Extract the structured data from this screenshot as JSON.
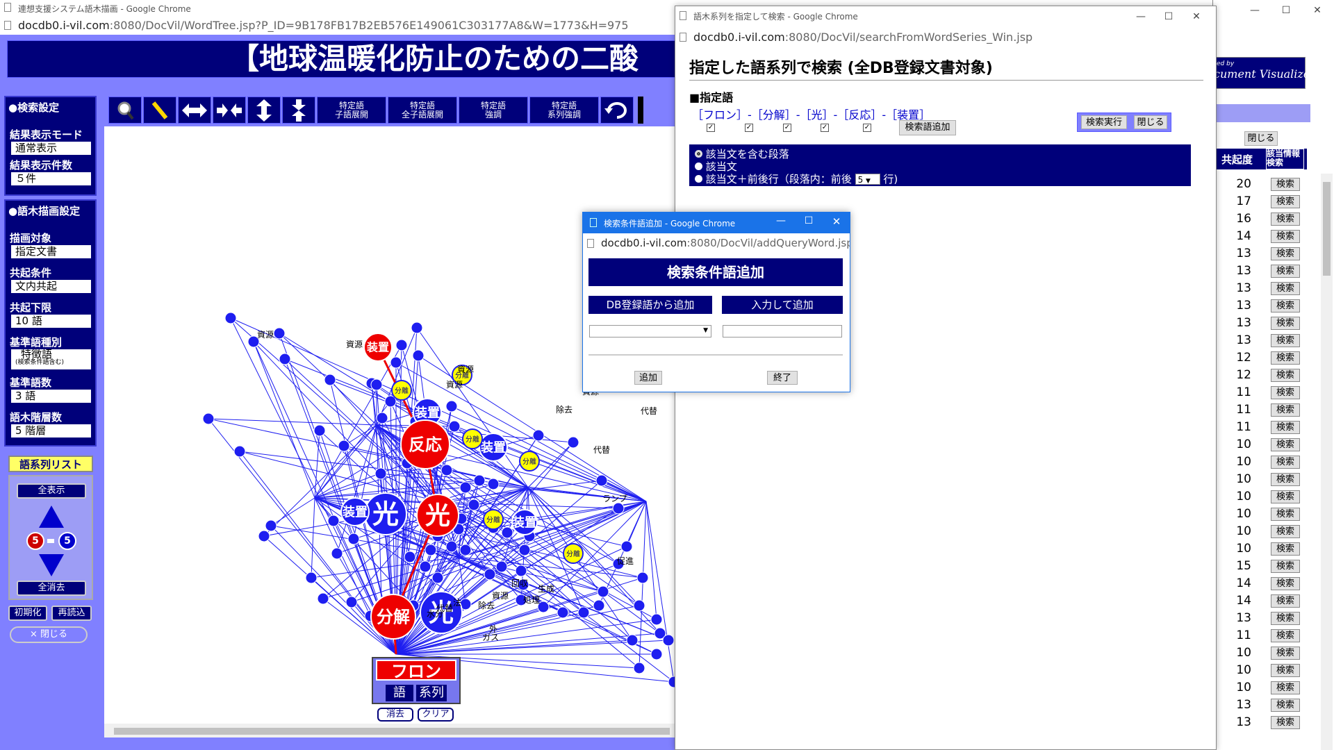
{
  "main_window": {
    "title": "連想支援システム語木描画 - Google Chrome",
    "url_host": "docdb0.i-vil.com",
    "url_rest": ":8080/DocVil/WordTree.jsp?P_ID=9B178FB17B2EB576E149061C303177A8&W=1773&H=975",
    "banner": "【地球温暖化防止のための二酸"
  },
  "sidebar": {
    "search_settings_head": "●検索設定",
    "result_mode_label": "結果表示モード",
    "result_mode_value": "通常表示",
    "result_count_label": "結果表示件数",
    "result_count_value": "５件",
    "tree_settings_head": "●語木描画設定",
    "target_label": "描画対象",
    "target_value": "指定文書",
    "cooc_label": "共起条件",
    "cooc_value": "文内共起",
    "cooc_limit_label": "共起下限",
    "cooc_limit_value": "10 語",
    "base_type_label": "基準語種別",
    "base_type_value": "特徴語",
    "base_type_note": "(検索条件語含む)",
    "base_count_label": "基準語数",
    "base_count_value": "3 語",
    "depth_label": "語木階層数",
    "depth_value": "5 階層",
    "series_list": "語系列リスト",
    "show_all": "全表示",
    "hide_all": "全消去",
    "range_left": "5",
    "range_right": "5",
    "init": "初期化",
    "reload": "再読込",
    "close": "× 閉じる"
  },
  "toolbar": {
    "b1": "特定語",
    "b1b": "子語展開",
    "b2": "特定語",
    "b2b": "全子語展開",
    "b3": "特定語",
    "b3b": "強調",
    "b4": "特定語",
    "b4b": "系列強調"
  },
  "tree": {
    "root": "フロン",
    "root_tab1": "語",
    "root_tab2": "系列",
    "erase": "消去",
    "clear": "クリア",
    "red_nodes": [
      "装置",
      "反応",
      "光",
      "分解"
    ],
    "blue_big": [
      "光",
      "光",
      "装置",
      "装置",
      "装置",
      "装置"
    ],
    "yellow": [
      "分離",
      "分離",
      "分離",
      "分離",
      "分離",
      "分離"
    ],
    "labels": [
      "資源",
      "資源",
      "資源",
      "資源",
      "資源",
      "除去",
      "代替",
      "代替",
      "ランプ",
      "促進",
      "生成",
      "処理",
      "回収",
      "外",
      "ガス",
      "水分",
      "法",
      "代替",
      "除去"
    ]
  },
  "search_window": {
    "title": "語木系列を指定して検索 - Google Chrome",
    "url_host": "docdb0.i-vil.com",
    "url_rest": ":8080/DocVil/searchFromWordSeries_Win.jsp",
    "heading": "指定した語系列で検索 (全DB登録文書対象)",
    "spec_label": "■指定語",
    "series": "［フロン］-［分解］-［光］-［反応］-［装置］",
    "add_word_btn": "検索語追加",
    "exec_btn": "検索実行",
    "close_btn": "閉じる",
    "opt1": "該当文を含む段落",
    "opt2": "該当文",
    "opt3": "該当文＋前後行（段落内：前後",
    "opt3_value": "5",
    "opt3_tail": "行)"
  },
  "add_window": {
    "title": "検索条件語追加 - Google Chrome",
    "url_host": "docdb0.i-vil.com",
    "url_rest": ":8080/DocVil/addQueryWord.jsp?",
    "heading": "検索条件語追加",
    "from_db": "DB登録語から追加",
    "by_input": "入力して追加",
    "add_btn": "追加",
    "end_btn": "終了"
  },
  "right_window": {
    "logo_small": "ed by",
    "logo": "cument Visualizer",
    "close_btn": "閉じる",
    "col1": "共起度",
    "col2": "該当情報",
    "col2b": "検索",
    "search_label": "検索",
    "counts": [
      "20",
      "17",
      "16",
      "14",
      "13",
      "13",
      "13",
      "13",
      "13",
      "13",
      "12",
      "12",
      "11",
      "11",
      "11",
      "10",
      "10",
      "10",
      "10",
      "10",
      "10",
      "10",
      "15",
      "14",
      "14",
      "13",
      "11",
      "10",
      "10",
      "10",
      "13",
      "13"
    ]
  }
}
